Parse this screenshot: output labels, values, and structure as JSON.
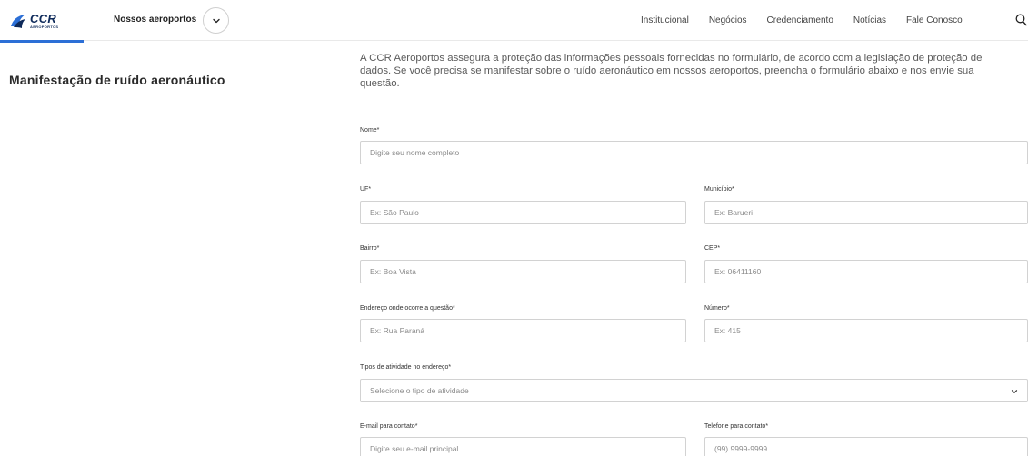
{
  "header": {
    "logo_main": "CCR",
    "logo_sub": "AEROPORTOS",
    "airports_label": "Nossos aeroportos",
    "nav": [
      "Institucional",
      "Negócios",
      "Credenciamento",
      "Notícias",
      "Fale Conosco"
    ],
    "accent_color": "#2c6fd6"
  },
  "page": {
    "title": "Manifestação de ruído aeronáutico",
    "intro": "A CCR Aeroportos assegura a proteção das informações pessoais fornecidas no formulário, de acordo com a legislação de proteção de dados.  Se você precisa se manifestar sobre o ruído aeronáutico em nossos aeroportos, preencha o formulário abaixo e nos envie sua questão."
  },
  "form": {
    "nome": {
      "label": "Nome*",
      "placeholder": "Digite seu nome completo"
    },
    "uf": {
      "label": "UF*",
      "placeholder": "Ex: São Paulo"
    },
    "municipio": {
      "label": "Município*",
      "placeholder": "Ex: Barueri"
    },
    "bairro": {
      "label": "Bairro*",
      "placeholder": "Ex: Boa Vista"
    },
    "cep": {
      "label": "CEP*",
      "placeholder": "Ex: 06411160"
    },
    "endereco": {
      "label": "Endereço onde ocorre a questão*",
      "placeholder": "Ex: Rua Paraná"
    },
    "numero": {
      "label": "Número*",
      "placeholder": "Ex: 415"
    },
    "tipos": {
      "label": "Tipos de atividade no endereço*",
      "placeholder": "Selecione o tipo de atividade"
    },
    "email": {
      "label": "E-mail para contato*",
      "placeholder": "Digite seu e-mail principal"
    },
    "telefone": {
      "label": "Telefone para contato*",
      "placeholder": "(99) 9999-9999"
    }
  }
}
